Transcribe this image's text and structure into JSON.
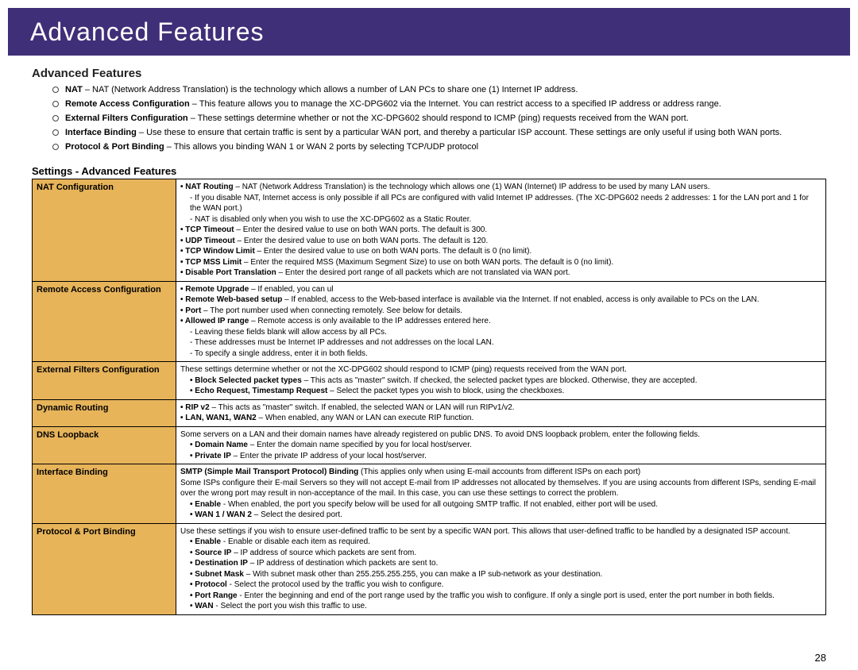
{
  "banner": "Advanced Features",
  "section_title": "Advanced Features",
  "intro": [
    {
      "term": "NAT",
      "desc": " – NAT (Network Address Translation) is the technology which allows a number of LAN PCs to share one (1) Internet IP address."
    },
    {
      "term": "Remote Access Configuration",
      "desc": " – This feature allows you to manage the XC-DPG602 via the Internet. You can restrict access to a specified IP address or address range."
    },
    {
      "term": "External Filters Configuration",
      "desc": " – These settings determine whether or not the XC-DPG602 should respond to ICMP (ping) requests received from the WAN port."
    },
    {
      "term": "Interface Binding",
      "desc": " – Use these to ensure that certain traffic is sent by a particular WAN port, and thereby a particular ISP account. These settings are only useful if using both WAN ports."
    },
    {
      "term": "Protocol & Port Binding",
      "desc": "  – This allows you binding WAN 1 or WAN 2 ports by selecting TCP/UDP protocol"
    }
  ],
  "subsection_title": "Settings - Advanced Features",
  "table": [
    {
      "label": "NAT Configuration",
      "lines": [
        {
          "b": "• NAT Routing",
          "t": " – NAT (Network Address Translation) is the technology which allows one (1) WAN (Internet) IP address to be used by many LAN users."
        },
        {
          "ind": 1,
          "t": "- If you disable NAT, Internet access is only possible if all PCs are configured with valid Internet IP addresses. (The XC-DPG602 needs 2 addresses: 1 for the LAN port and 1 for the WAN port.)"
        },
        {
          "ind": 1,
          "t": "- NAT is disabled only when you wish to use the XC-DPG602 as a Static Router."
        },
        {
          "b": "• TCP Timeout",
          "t": " – Enter the desired value to use on both WAN ports. The default is 300."
        },
        {
          "b": "• UDP Timeout",
          "t": " – Enter the desired value to use on both WAN ports. The default is 120."
        },
        {
          "b": "• TCP Window Limit",
          "t": " – Enter the desired value to use on both WAN ports. The default is 0 (no limit)."
        },
        {
          "b": "• TCP MSS Limit",
          "t": " – Enter the required MSS (Maximum Segment Size) to use on both WAN ports. The default is 0 (no limit)."
        },
        {
          "b": "• Disable Port Translation",
          "t": " – Enter the desired port range of all packets which are not translated via WAN port."
        }
      ]
    },
    {
      "label": "Remote Access Configuration",
      "lines": [
        {
          "b": "• Remote Upgrade",
          "t": " – If enabled, you can ul"
        },
        {
          "b": "• Remote Web-based setup",
          "t": " – If enabled, access to the Web-based interface is available via the Internet. If not enabled, access is only available to PCs on the LAN."
        },
        {
          "b": "• Port",
          "t": " – The port number used when connecting remotely. See below for details."
        },
        {
          "b": "• Allowed IP range",
          "t": " – Remote access is only available to the IP addresses entered here."
        },
        {
          "ind": 1,
          "t": "- Leaving these fields blank will allow access by all PCs."
        },
        {
          "ind": 1,
          "t": "- These addresses must be Internet IP addresses and not addresses on the local LAN."
        },
        {
          "ind": 1,
          "t": "- To specify a single address, enter it in both fields."
        }
      ]
    },
    {
      "label": "External Filters Configuration",
      "lines": [
        {
          "t": "These settings determine whether or not the XC-DPG602 should respond to ICMP (ping) requests received from the WAN port."
        },
        {
          "ind": 1,
          "b": "• Block Selected packet types",
          "t": " – This acts as \"master\" switch. If checked, the selected packet types are blocked. Otherwise, they are accepted."
        },
        {
          "ind": 1,
          "b": "• Echo Request, Timestamp Request",
          "t": " –  Select the packet types you wish to block, using the checkboxes."
        }
      ]
    },
    {
      "label": "Dynamic Routing",
      "lines": [
        {
          "b": "• RIP v2",
          "t": " – This acts as \"master\" switch. If enabled, the selected WAN or LAN will run RIPv1/v2."
        },
        {
          "b": "• LAN, WAN1, WAN2",
          "t": " – When enabled, any WAN or LAN can execute RIP function."
        }
      ]
    },
    {
      "label": "DNS Loopback",
      "lines": [
        {
          "t": "Some servers on a LAN and their domain names have already registered on public DNS. To avoid DNS loopback problem, enter the following fields."
        },
        {
          "ind": 1,
          "b": "• Domain Name",
          "t": " – Enter the domain name specified by you for local host/server."
        },
        {
          "ind": 1,
          "b": "• Private IP",
          "t": " – Enter the private IP address of your local host/server."
        }
      ]
    },
    {
      "label": "Interface Binding",
      "lines": [
        {
          "b": "SMTP (Simple Mail Transport Protocol) Binding",
          "t": " (This applies only when using E-mail accounts from different ISPs on each port)"
        },
        {
          "t": "Some ISPs configure their E-mail Servers so they will not accept E-mail from IP addresses not allocated by themselves. If you are using accounts from different ISPs, sending E-mail over the wrong port may result in non-acceptance of the mail. In this case, you can use these settings to correct the problem."
        },
        {
          "ind": 1,
          "b": "• Enable",
          "t": " - When enabled, the port you specify below will be used for all outgoing SMTP traffic. If not enabled, either port will be used."
        },
        {
          "ind": 1,
          "b": "• WAN 1 / WAN 2",
          "t": " – Select the desired port."
        }
      ]
    },
    {
      "label": "Protocol & Port Binding",
      "lines": [
        {
          "t": "Use these settings if you wish to ensure user-defined traffic to be sent by a specific WAN port. This allows that user-defined traffic to be handled by a designated ISP account."
        },
        {
          "ind": 1,
          "b": "• Enable",
          "t": " - Enable or disable each item as required."
        },
        {
          "ind": 1,
          "b": "• Source IP",
          "t": " – IP address of source which packets are sent from."
        },
        {
          "ind": 1,
          "b": "• Destination IP",
          "t": " – IP address of destination which packets are sent to."
        },
        {
          "ind": 1,
          "b": "• Subnet Mask",
          "t": " – With subnet mask other than 255.255.255.255, you can make a IP sub-network as your destination."
        },
        {
          "ind": 1,
          "b": "• Protocol",
          "t": " - Select the protocol used by the traffic you wish to configure."
        },
        {
          "ind": 1,
          "b": "• Port Range",
          "t": " - Enter the beginning and end of the port range used by the traffic you wish to configure. If only a single port is used, enter the port number in both fields."
        },
        {
          "ind": 1,
          "b": "• WAN",
          "t": " - Select the port you wish this traffic to use."
        }
      ]
    }
  ],
  "page_number": "28"
}
